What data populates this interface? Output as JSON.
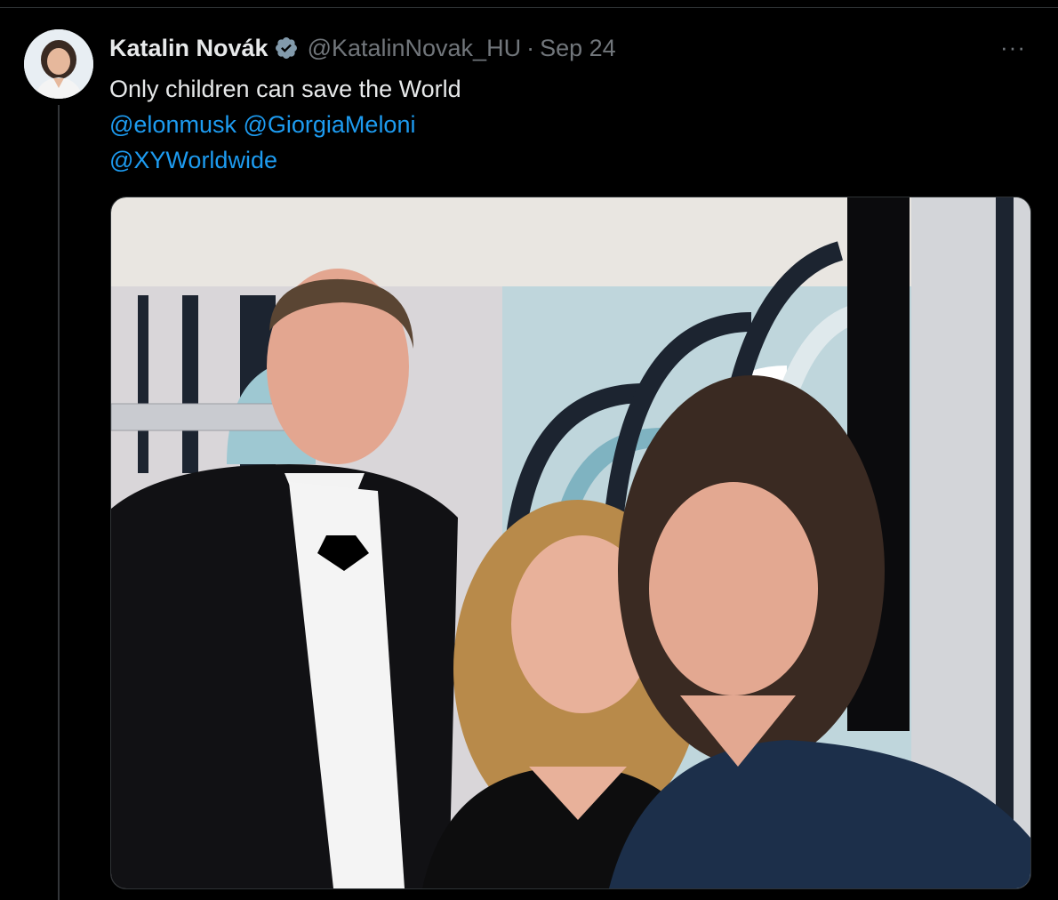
{
  "tweet": {
    "author_name": "Katalin Novák",
    "author_handle": "@KatalinNovak_HU",
    "separator": "·",
    "date": "Sep 24",
    "more_label": "···",
    "text_line1": "Only children can save the World",
    "mention1": "@elonmusk",
    "mention2": "@GiorgiaMeloni",
    "mention3": "@XYWorldwide"
  },
  "icons": {
    "verified": "verified-badge-icon",
    "more": "more-options-icon"
  },
  "colors": {
    "background": "#000000",
    "text": "#e7e9ea",
    "secondary": "#71767b",
    "link": "#1d9bf0",
    "border": "#2f3336"
  }
}
